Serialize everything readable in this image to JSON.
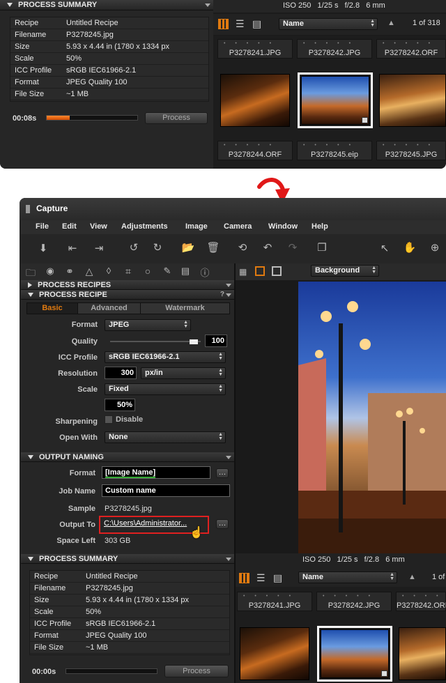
{
  "top": {
    "summary_title": "PROCESS SUMMARY",
    "summary": [
      {
        "k": "Recipe",
        "v": "Untitled Recipe"
      },
      {
        "k": "Filename",
        "v": "P3278245.jpg"
      },
      {
        "k": "Size",
        "v": "5.93 x 4.44 in (1780 x 1334 px"
      },
      {
        "k": "Scale",
        "v": "50%"
      },
      {
        "k": "ICC Profile",
        "v": "sRGB IEC61966-2.1"
      },
      {
        "k": "Format",
        "v": "JPEG Quality 100"
      },
      {
        "k": "File Size",
        "v": "~1 MB"
      }
    ],
    "time": "00:08s",
    "progress": 0.25,
    "process_label": "Process",
    "exif": "ISO 250   1/25 s   f/2.8   6 mm",
    "sort": "Name",
    "page_count": "1 of 318",
    "thumbs_row1": [
      "P3278241.JPG",
      "P3278242.JPG",
      "P3278242.ORF"
    ],
    "thumbs_row2": [
      "P3278244.ORF",
      "P3278245.eip",
      "P3278245.JPG"
    ]
  },
  "app": {
    "title": "Capture",
    "menu": [
      "File",
      "Edit",
      "View",
      "Adjustments",
      "Image",
      "Camera",
      "Window",
      "Help"
    ],
    "background_select": "Background",
    "process_recipes": "PROCESS RECIPES",
    "process_recipe": "PROCESS RECIPE",
    "tabs": [
      "Basic",
      "Advanced",
      "Watermark"
    ],
    "recipe": {
      "format_label": "Format",
      "format": "JPEG",
      "quality_label": "Quality",
      "quality": "100",
      "icc_label": "ICC Profile",
      "icc": "sRGB IEC61966-2.1",
      "res_label": "Resolution",
      "res": "300",
      "res_unit": "px/in",
      "scale_label": "Scale",
      "scale": "Fixed",
      "scale_value": "50%",
      "sharp_label": "Sharpening",
      "sharp": "Disable",
      "open_label": "Open With",
      "open": "None"
    },
    "output_naming": "OUTPUT NAMING",
    "naming": {
      "format_label": "Format",
      "format": "[Image Name]",
      "job_label": "Job Name",
      "job": "Custom name",
      "sample_label": "Sample",
      "sample": "P3278245.jpg",
      "output_label": "Output To",
      "output": "C:\\Users\\Administrator...",
      "space_label": "Space Left",
      "space": "303 GB"
    },
    "exif": "ISO 250   1/25 s   f/2.8   6 mm",
    "summary_title": "PROCESS SUMMARY",
    "summary": [
      {
        "k": "Recipe",
        "v": "Untitled Recipe"
      },
      {
        "k": "Filename",
        "v": "P3278245.jpg"
      },
      {
        "k": "Size",
        "v": "5.93 x 4.44 in (1780 x 1334 px"
      },
      {
        "k": "Scale",
        "v": "50%"
      },
      {
        "k": "ICC Profile",
        "v": "sRGB IEC61966-2.1"
      },
      {
        "k": "Format",
        "v": "JPEG Quality 100"
      },
      {
        "k": "File Size",
        "v": "~1 MB"
      }
    ],
    "time": "00:00s",
    "progress": 0,
    "process_label": "Process",
    "sort": "Name",
    "page_count": "1 of",
    "thumbs_row1": [
      "P3278241.JPG",
      "P3278242.JPG",
      "P3278242.ORF"
    ],
    "colors": {
      "accent": "#e07a10",
      "highlight": "#e02020"
    }
  }
}
